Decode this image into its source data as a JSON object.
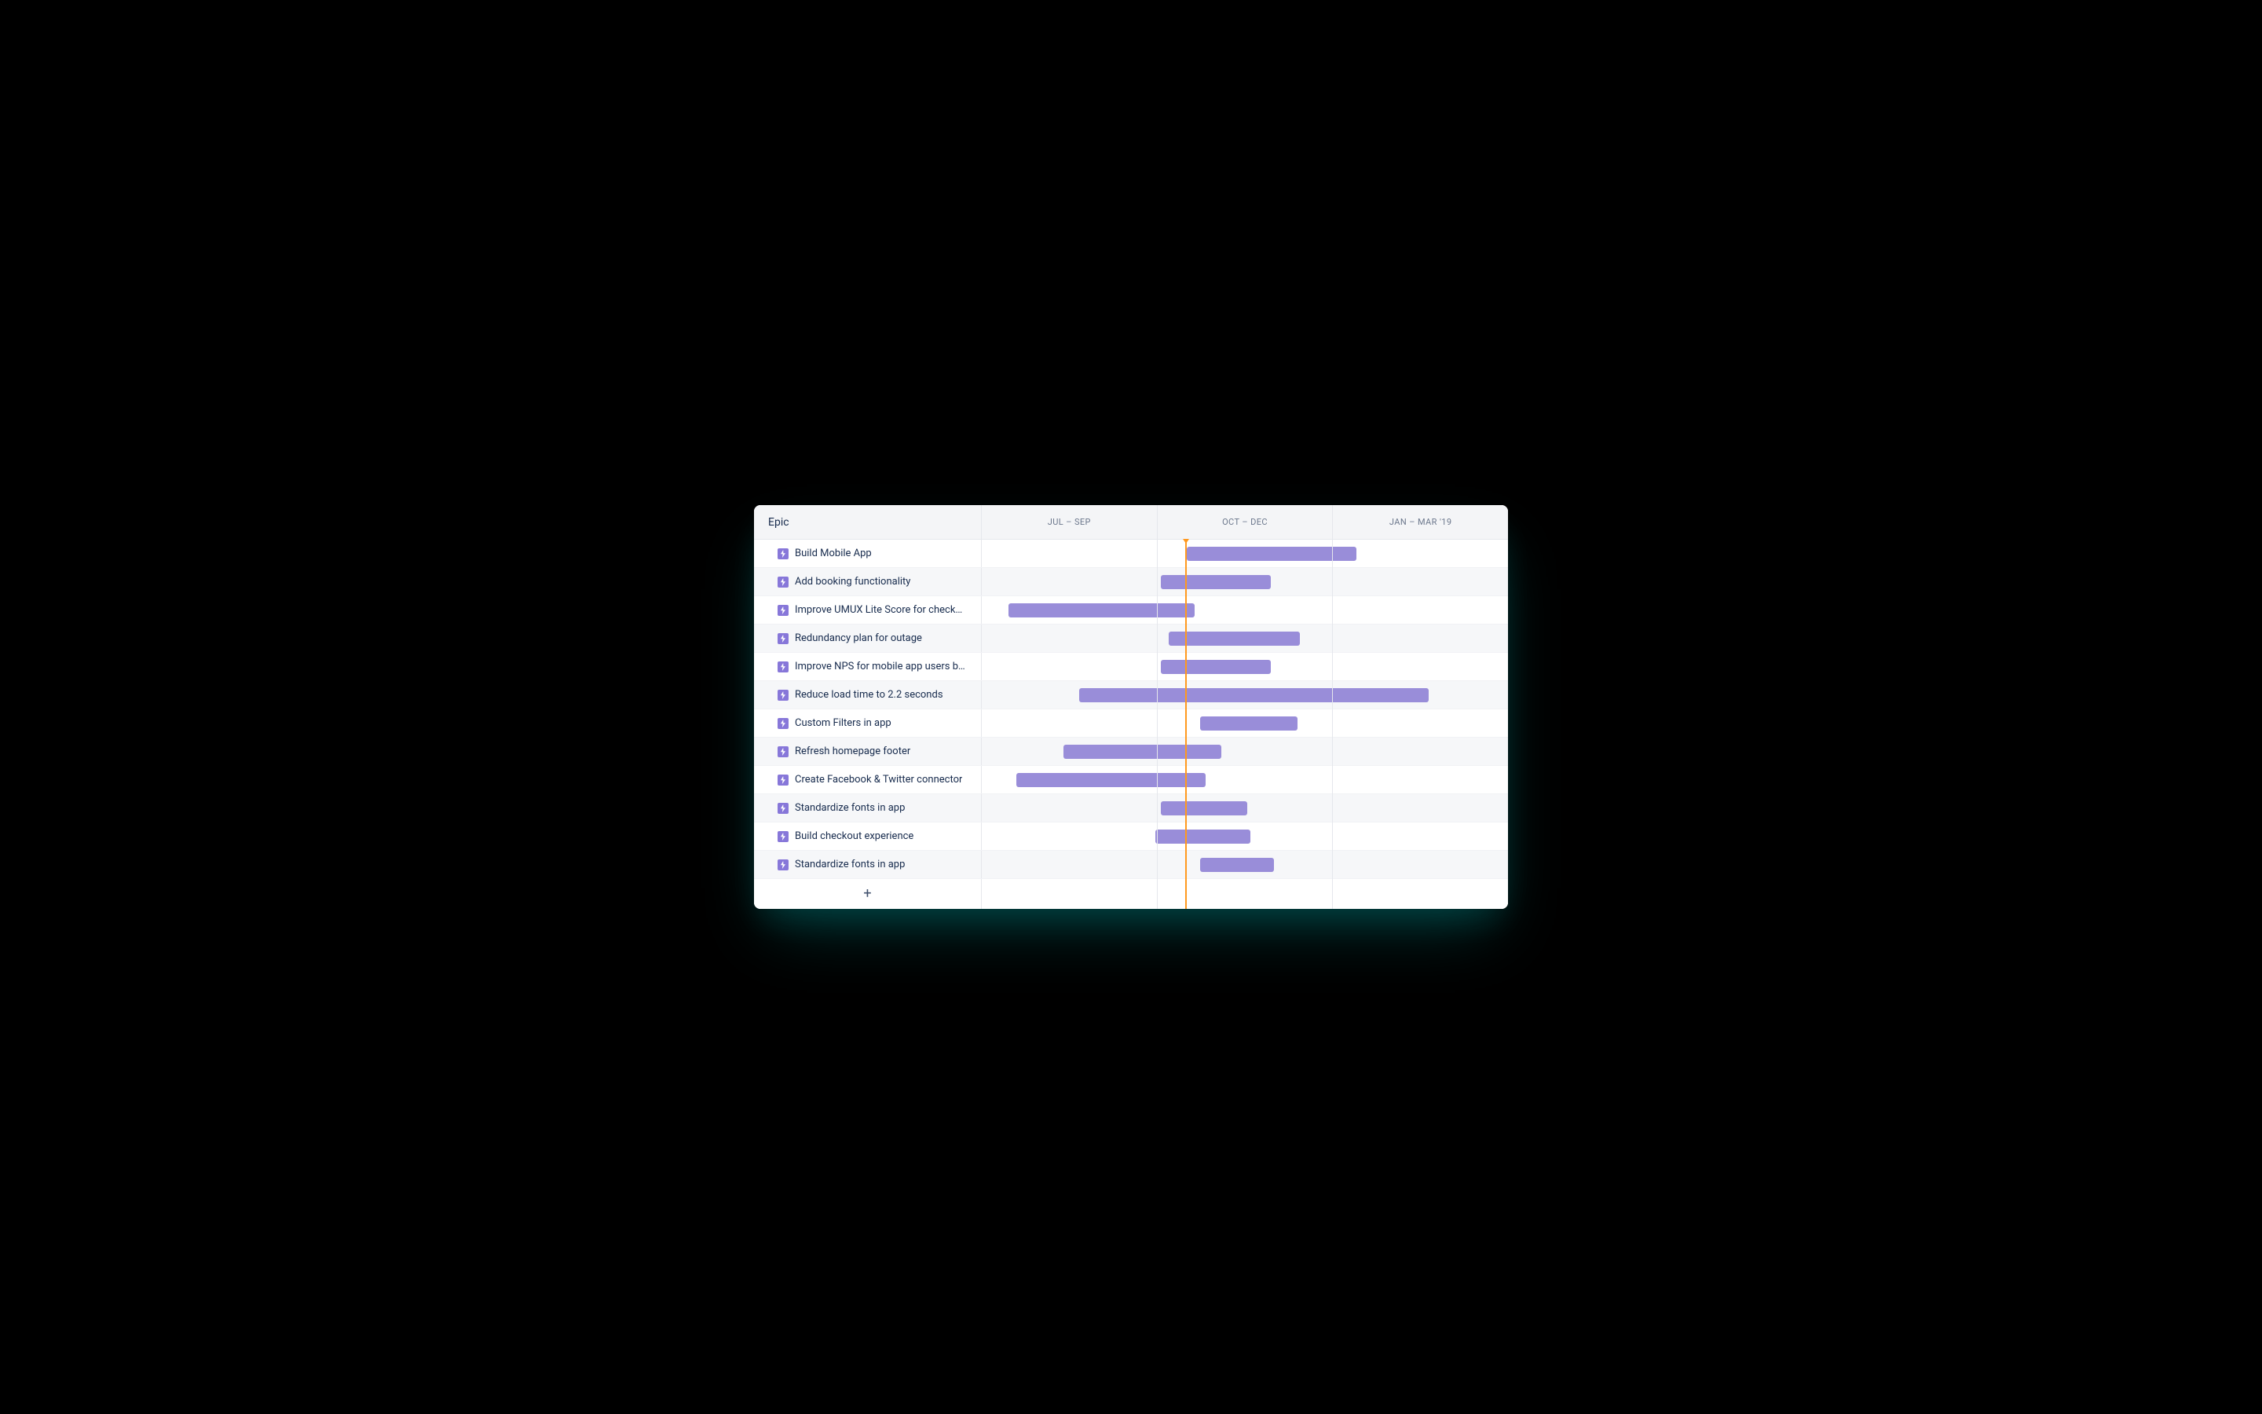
{
  "header": {
    "epic_label": "Epic",
    "columns": [
      "JUL – SEP",
      "OCT – DEC",
      "JAN – MAR '19"
    ]
  },
  "timeline": {
    "today_percent": 38.7,
    "bar_color": "#998dd9",
    "icon_color": "#8777d9",
    "today_color": "#ff991f"
  },
  "epics": [
    {
      "label": "Build Mobile App",
      "start_pct": 39.0,
      "end_pct": 71.2
    },
    {
      "label": "Add booking functionality",
      "start_pct": 34.0,
      "end_pct": 55.0
    },
    {
      "label": "Improve UMUX Lite Score for checko…",
      "start_pct": 5.0,
      "end_pct": 40.5
    },
    {
      "label": "Redundancy plan for outage",
      "start_pct": 35.5,
      "end_pct": 60.5
    },
    {
      "label": "Improve NPS for mobile app users by …",
      "start_pct": 34.0,
      "end_pct": 55.0
    },
    {
      "label": "Reduce load time to 2.2 seconds",
      "start_pct": 18.5,
      "end_pct": 85.0
    },
    {
      "label": "Custom Filters in app",
      "start_pct": 41.5,
      "end_pct": 60.0
    },
    {
      "label": "Refresh homepage footer",
      "start_pct": 15.5,
      "end_pct": 45.5
    },
    {
      "label": "Create Facebook & Twitter connector",
      "start_pct": 6.5,
      "end_pct": 42.5
    },
    {
      "label": "Standardize fonts in app",
      "start_pct": 34.0,
      "end_pct": 50.5
    },
    {
      "label": "Build checkout experience",
      "start_pct": 33.0,
      "end_pct": 51.0
    },
    {
      "label": "Standardize fonts in app",
      "start_pct": 41.5,
      "end_pct": 55.5
    }
  ],
  "add_button": {
    "glyph": "+"
  }
}
